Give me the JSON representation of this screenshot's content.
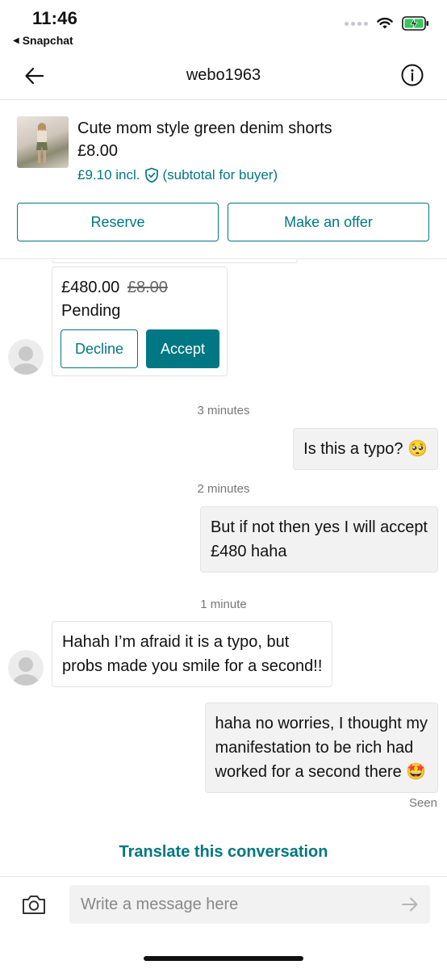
{
  "status_bar": {
    "time": "11:46",
    "back_app": "Snapchat"
  },
  "header": {
    "title": "webo1963"
  },
  "item": {
    "title": "Cute mom style green denim shorts",
    "price": "£8.00",
    "incl_price": "£9.10 incl.",
    "incl_note": "(subtotal for buyer)",
    "reserve_label": "Reserve",
    "offer_label": "Make an offer"
  },
  "offer_card": {
    "price": "£480.00",
    "old_price": "£8.00",
    "status": "Pending",
    "decline_label": "Decline",
    "accept_label": "Accept"
  },
  "messages": [
    {
      "timestamp": "3 minutes"
    },
    {
      "text": "Is this a typo? 🥺"
    },
    {
      "timestamp": "2 minutes"
    },
    {
      "line1": "But if not then yes I will accept",
      "line2": "£480 haha"
    },
    {
      "timestamp": "1 minute"
    },
    {
      "line1": "Hahah I’m afraid it is a typo, but",
      "line2": "probs made you smile for a second!!"
    },
    {
      "line1": "haha no worries, I thought my",
      "line2": "manifestation to be rich had",
      "line3": "worked for a second there 🤩"
    }
  ],
  "seen": "Seen",
  "translate_label": "Translate this conversation",
  "composer": {
    "placeholder": "Write a message here"
  },
  "colors": {
    "accent": "#007782",
    "bubble_out": "#f2f2f2",
    "border": "#e3e3e3"
  },
  "icons": [
    "back-arrow-icon",
    "info-icon",
    "shield-check-icon",
    "camera-icon",
    "send-arrow-icon",
    "wifi-icon",
    "battery-charging-icon"
  ]
}
